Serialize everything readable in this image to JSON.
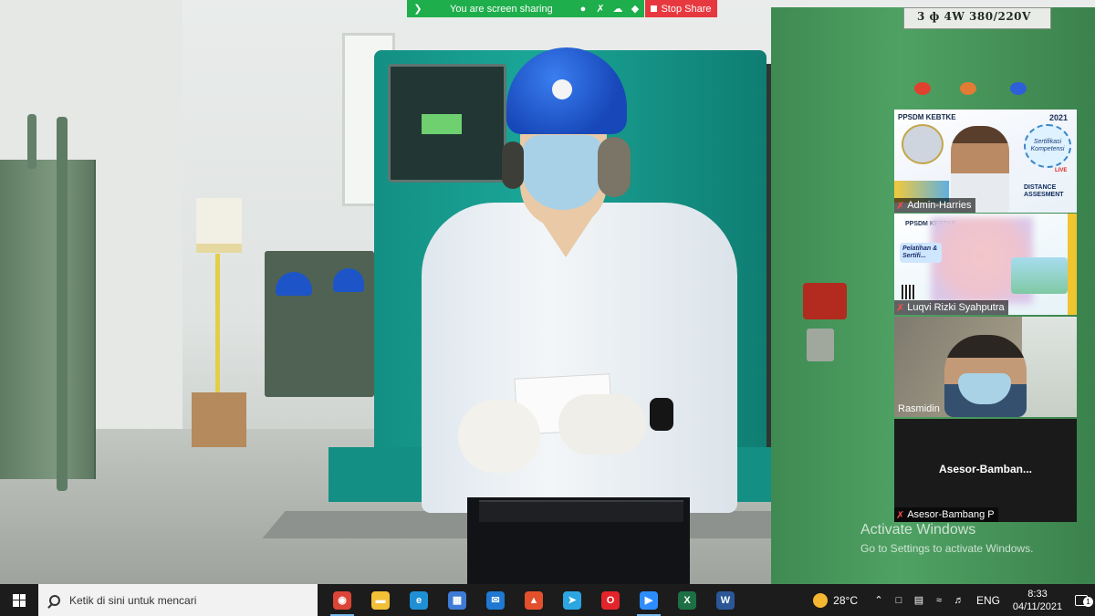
{
  "share_bar": {
    "label": "You are screen sharing",
    "stop_label": "Stop Share",
    "color": "#1fae4c",
    "stop_color": "#e8383f"
  },
  "scene": {
    "nameplate": "3 ф 4W 380/220V"
  },
  "participants": [
    {
      "name": "Admin-Harries",
      "muted": true,
      "content": {
        "header": "PPSDM KEBTKE",
        "year": "2021",
        "badge": "Sertifikasi Kompetensi",
        "live": "LIVE",
        "caption": "DISTANCE ASSESMENT"
      }
    },
    {
      "name": "Luqvi Rizki Syahputra",
      "muted": true,
      "content": {
        "header": "PPSDM KEBTKE",
        "title": "Pelatihan & Sertifi..."
      }
    },
    {
      "name": "Rasmidin",
      "muted": false
    },
    {
      "name": "Asesor-Bambang P",
      "display_name": "Asesor-Bamban...",
      "muted": true
    }
  ],
  "watermark": {
    "title": "Activate Windows",
    "subtitle": "Go to Settings to activate Windows."
  },
  "taskbar": {
    "search_placeholder": "Ketik di sini untuk mencari",
    "apps": [
      {
        "icon": "chrome-icon",
        "color": "#db4437",
        "glyph": "◉",
        "active": true
      },
      {
        "icon": "file-explorer-icon",
        "color": "#f2c037",
        "glyph": "▬",
        "active": false
      },
      {
        "icon": "edge-icon",
        "color": "#1f8fd6",
        "glyph": "e",
        "active": false
      },
      {
        "icon": "microsoft-store-icon",
        "color": "#3e7bd6",
        "glyph": "▦",
        "active": false
      },
      {
        "icon": "mail-icon",
        "color": "#1f78d1",
        "glyph": "✉",
        "active": false
      },
      {
        "icon": "pdf-reader-icon",
        "color": "#e2512c",
        "glyph": "▲",
        "active": false
      },
      {
        "icon": "telegram-icon",
        "color": "#2ca5e0",
        "glyph": "➤",
        "active": false
      },
      {
        "icon": "opera-icon",
        "color": "#e3242b",
        "glyph": "O",
        "active": false
      },
      {
        "icon": "zoom-icon",
        "color": "#2d8cff",
        "glyph": "▶",
        "active": true
      },
      {
        "icon": "excel-icon",
        "color": "#1d7044",
        "glyph": "X",
        "active": false
      },
      {
        "icon": "word-icon",
        "color": "#2b5797",
        "glyph": "W",
        "active": false
      }
    ],
    "temperature": "28°C",
    "language": "ENG",
    "time": "8:33",
    "date": "04/11/2021",
    "notifications": "1"
  }
}
